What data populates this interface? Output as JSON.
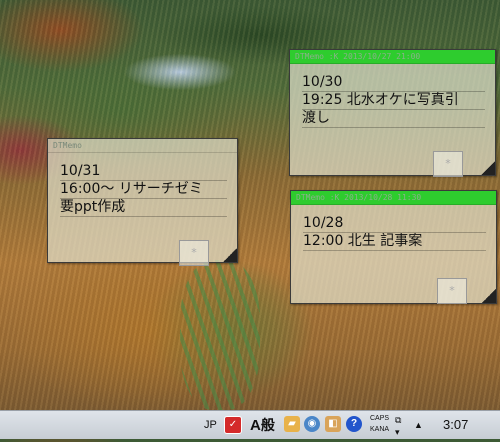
{
  "memos": [
    {
      "title": "DTMemo",
      "lines": [
        "10/31",
        "16:00～ リサーチゼミ",
        "要ppt作成"
      ],
      "mark": "*"
    },
    {
      "title": "DTMemo :K 2013/10/27 21:00",
      "lines": [
        "10/30",
        "19:25 北水オケに写真引",
        "渡し"
      ],
      "mark": "*"
    },
    {
      "title": "DTMemo :K 2013/10/28 11:30",
      "lines": [
        "10/28",
        "12:00 北生 記事案"
      ],
      "mark": "*"
    }
  ],
  "taskbar": {
    "lang": "JP",
    "ime_mode": "A",
    "ime_kanji": "般",
    "caps": "CAPS",
    "kana": "KANA",
    "clock": "3:07",
    "help_icon": "?"
  },
  "colors": {
    "memo_title_active": "#2ecc2e",
    "memo_bg": "#e1e1cd",
    "taskbar": "#d4d9df"
  },
  "icons": [
    "check-icon",
    "ime-toolbar-icon",
    "folder-icon",
    "disk-icon",
    "package-icon",
    "help-icon",
    "tray-expand-icon",
    "flag-icon",
    "speaker-icon",
    "network-icon",
    "show-hidden-icons"
  ]
}
